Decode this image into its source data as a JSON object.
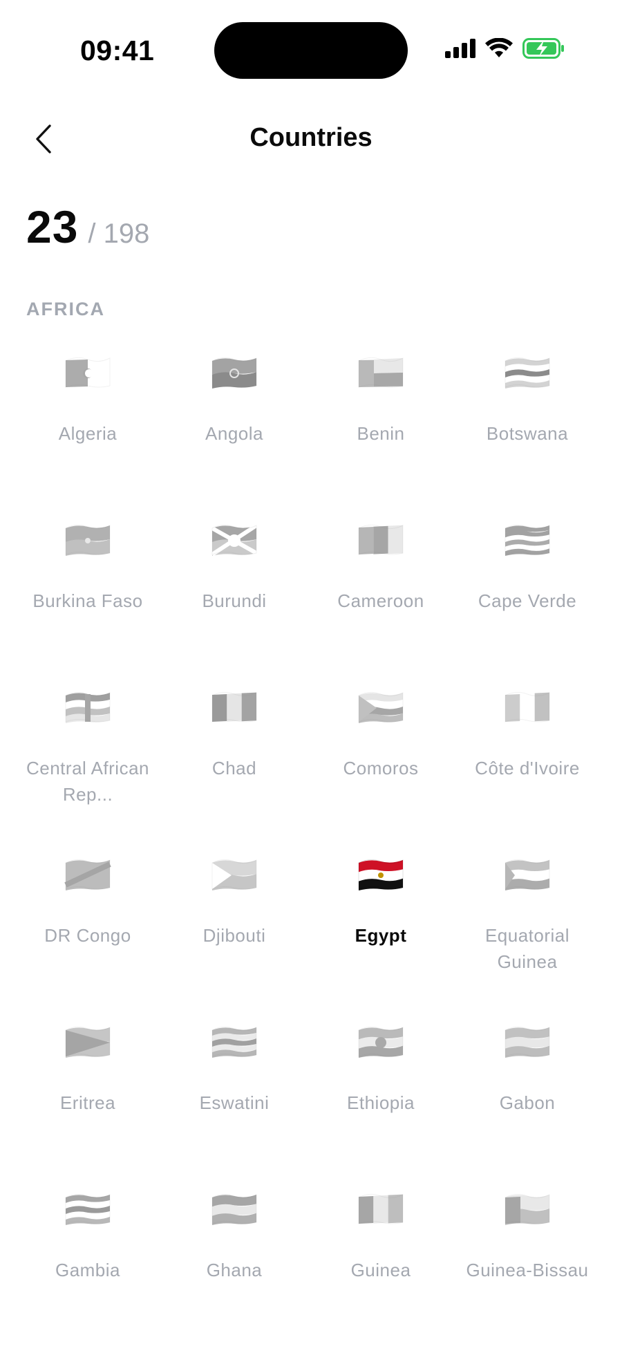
{
  "status_bar": {
    "time": "09:41",
    "icons": [
      "cellular-signal-icon",
      "wifi-icon",
      "battery-charging-icon"
    ],
    "battery_color": "#34c759"
  },
  "nav": {
    "title": "Countries",
    "back_icon": "chevron-left-icon"
  },
  "count": {
    "visited": "23",
    "total": "/ 198"
  },
  "section": {
    "title": "AFRICA"
  },
  "colors": {
    "muted_text": "#a4a8b0",
    "active_text": "#0a0a0a"
  },
  "countries": [
    {
      "name": "Algeria",
      "visited": false,
      "flag_icon": "algeria-flag-icon"
    },
    {
      "name": "Angola",
      "visited": false,
      "flag_icon": "angola-flag-icon"
    },
    {
      "name": "Benin",
      "visited": false,
      "flag_icon": "benin-flag-icon"
    },
    {
      "name": "Botswana",
      "visited": false,
      "flag_icon": "botswana-flag-icon"
    },
    {
      "name": "Burkina Faso",
      "visited": false,
      "flag_icon": "burkina-faso-flag-icon"
    },
    {
      "name": "Burundi",
      "visited": false,
      "flag_icon": "burundi-flag-icon"
    },
    {
      "name": "Cameroon",
      "visited": false,
      "flag_icon": "cameroon-flag-icon"
    },
    {
      "name": "Cape Verde",
      "visited": false,
      "flag_icon": "cape-verde-flag-icon"
    },
    {
      "name": "Central African Rep...",
      "visited": false,
      "flag_icon": "central-african-republic-flag-icon"
    },
    {
      "name": "Chad",
      "visited": false,
      "flag_icon": "chad-flag-icon"
    },
    {
      "name": "Comoros",
      "visited": false,
      "flag_icon": "comoros-flag-icon"
    },
    {
      "name": "Côte d'Ivoire",
      "visited": false,
      "flag_icon": "cote-divoire-flag-icon"
    },
    {
      "name": "DR Congo",
      "visited": false,
      "flag_icon": "dr-congo-flag-icon"
    },
    {
      "name": "Djibouti",
      "visited": false,
      "flag_icon": "djibouti-flag-icon"
    },
    {
      "name": "Egypt",
      "visited": true,
      "flag_icon": "egypt-flag-icon"
    },
    {
      "name": "Equatorial Guinea",
      "visited": false,
      "flag_icon": "equatorial-guinea-flag-icon"
    },
    {
      "name": "Eritrea",
      "visited": false,
      "flag_icon": "eritrea-flag-icon"
    },
    {
      "name": "Eswatini",
      "visited": false,
      "flag_icon": "eswatini-flag-icon"
    },
    {
      "name": "Ethiopia",
      "visited": false,
      "flag_icon": "ethiopia-flag-icon"
    },
    {
      "name": "Gabon",
      "visited": false,
      "flag_icon": "gabon-flag-icon"
    },
    {
      "name": "Gambia",
      "visited": false,
      "flag_icon": "gambia-flag-icon"
    },
    {
      "name": "Ghana",
      "visited": false,
      "flag_icon": "ghana-flag-icon"
    },
    {
      "name": "Guinea",
      "visited": false,
      "flag_icon": "guinea-flag-icon"
    },
    {
      "name": "Guinea-Bissau",
      "visited": false,
      "flag_icon": "guinea-bissau-flag-icon"
    }
  ]
}
